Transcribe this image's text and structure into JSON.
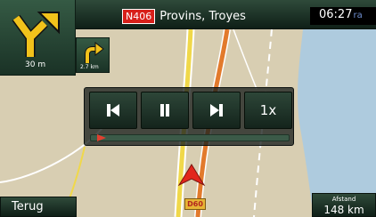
{
  "top_bar": {
    "road_number": "N406",
    "street_name": "Provins, Troyes",
    "time": "06:27",
    "time_suffix": "ra"
  },
  "turn_main": {
    "distance": "30 m",
    "icon": "turn-right-fork-icon"
  },
  "turn_next": {
    "distance": "2.7 km",
    "icon": "turn-right-icon"
  },
  "player": {
    "speed_label": "1x",
    "progress": 0.03,
    "buttons": [
      "skip-previous-icon",
      "pause-icon",
      "skip-next-icon"
    ]
  },
  "bottom": {
    "back_label": "Terug",
    "distance_label": "Afstand",
    "distance_value": "148 km"
  },
  "map": {
    "road_shield": "D60",
    "water_color": "#aecbde",
    "land_color": "#d8ceb2",
    "route_color": "#e27a2c"
  }
}
